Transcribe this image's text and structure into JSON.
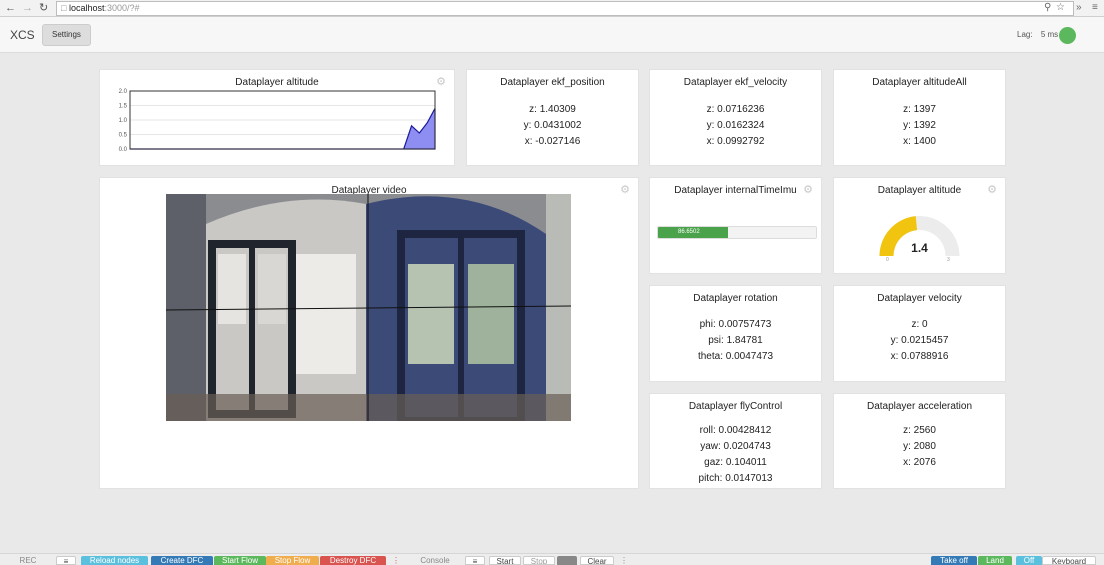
{
  "browser": {
    "page_icon": "page-icon",
    "url_host": "localhost",
    "url_path": ":3000/?#"
  },
  "topbar": {
    "brand": "XCS",
    "settings_label": "Settings",
    "lag_label": "Lag:",
    "lag_value": "5 ms",
    "status_color": "#5cb85c"
  },
  "panels": {
    "altitude_chart": {
      "title": "Dataplayer altitude",
      "chart_data": {
        "type": "area",
        "x": [
          0,
          1,
          2,
          3,
          4,
          5,
          6,
          7,
          8,
          9,
          10,
          11,
          12,
          13,
          14,
          15,
          16,
          17,
          18,
          19,
          20,
          21,
          22,
          23,
          24,
          25,
          26,
          27,
          28,
          29,
          30,
          31,
          32,
          33,
          34,
          35,
          36,
          37,
          38,
          39
        ],
        "values": [
          0,
          0,
          0,
          0,
          0,
          0,
          0,
          0,
          0,
          0,
          0,
          0,
          0,
          0,
          0,
          0,
          0,
          0,
          0,
          0,
          0,
          0,
          0,
          0,
          0,
          0,
          0,
          0,
          0,
          0,
          0,
          0,
          0,
          0,
          0,
          0,
          0.8,
          0.55,
          0.9,
          1.4
        ],
        "yticks": [
          "2.0",
          "1.5",
          "1.0",
          "0.5",
          "0.0"
        ],
        "ylim": [
          0,
          2.0
        ],
        "xlabel": "",
        "ylabel": "",
        "grid": true
      }
    },
    "ekf_position": {
      "title": "Dataplayer ekf_position",
      "lines": [
        "z: 1.40309",
        "y: 0.0431002",
        "x: -0.027146"
      ]
    },
    "ekf_velocity": {
      "title": "Dataplayer ekf_velocity",
      "lines": [
        "z: 0.0716236",
        "y: 0.0162324",
        "x: 0.0992792"
      ]
    },
    "altitude_all": {
      "title": "Dataplayer altitudeAll",
      "lines": [
        "z: 1397",
        "y: 1392",
        "x: 1400"
      ]
    },
    "video": {
      "title": "Dataplayer video"
    },
    "internal_time": {
      "title": "Dataplayer internalTimeImu",
      "progress_text": "86.6502",
      "progress_fraction": 0.44
    },
    "altitude_gauge": {
      "title": "Dataplayer altitude",
      "value": "1.4",
      "min": "0",
      "max": "3",
      "fraction": 0.47
    },
    "rotation": {
      "title": "Dataplayer rotation",
      "lines": [
        "phi: 0.00757473",
        "psi: 1.84781",
        "theta: 0.0047473"
      ]
    },
    "velocity": {
      "title": "Dataplayer velocity",
      "lines": [
        "z: 0",
        "y: 0.0215457",
        "x: 0.0788916"
      ]
    },
    "fly_control": {
      "title": "Dataplayer flyControl",
      "lines": [
        "roll: 0.00428412",
        "yaw: 0.0204743",
        "gaz: 0.104011",
        "pitch: 0.0147013"
      ]
    },
    "acceleration": {
      "title": "Dataplayer acceleration",
      "lines": [
        "z: 2560",
        "y: 2080",
        "x: 2076"
      ]
    }
  },
  "bottombar": {
    "rec_label": "REC",
    "reload_label": "Reload nodes",
    "create_label": "Create DFC",
    "start_flow_label": "Start Flow",
    "stop_flow_label": "Stop Flow",
    "destroy_label": "Destroy DFC",
    "console_label": "Console",
    "start_label": "Start",
    "stop_label": "Stop",
    "clear_label": "Clear",
    "takeoff_label": "Take off",
    "land_label": "Land",
    "off_label": "Off",
    "keyboard_label": "Keyboard",
    "colors": {
      "reload": "#5bc0de",
      "create": "#337ab7",
      "start_flow": "#5cb85c",
      "stop_flow": "#f0ad4e",
      "destroy": "#d9534f",
      "takeoff": "#337ab7",
      "land": "#5cb85c",
      "off": "#5bc0de"
    }
  }
}
